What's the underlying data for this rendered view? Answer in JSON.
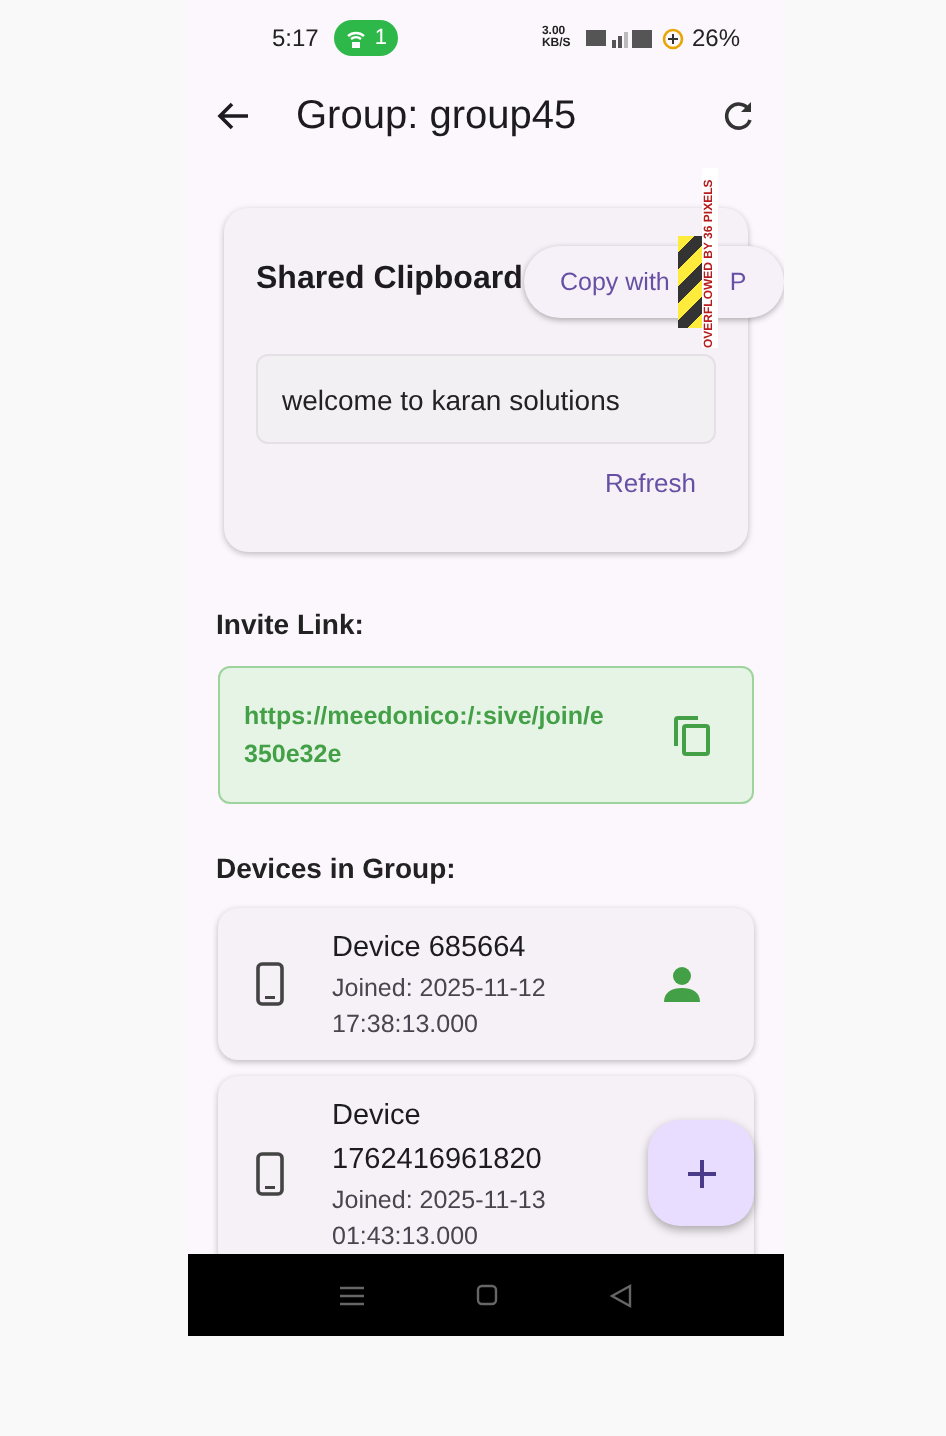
{
  "status_bar": {
    "time": "5:17",
    "hotspot_count": "1",
    "speed": "3.00 KB/S",
    "battery": "26%"
  },
  "app_bar": {
    "title": "Group: group45"
  },
  "clipboard": {
    "title": "Shared Clipboard",
    "copy_button_start": "Copy with",
    "copy_button_end": "P",
    "overflow_warning": "OVERFLOWED BY 36 PIXELS",
    "text": "welcome to karan solutions",
    "refresh": "Refresh"
  },
  "invite": {
    "heading": "Invite Link:",
    "link": "https://meedonico:/:sive/join/e350e32e"
  },
  "devices_heading": "Devices in Group:",
  "devices": [
    {
      "name": "Device 685664",
      "joined": "Joined: 2025-11-12 17:38:13.000",
      "current": true
    },
    {
      "name": "Device 1762416961820",
      "joined": "Joined: 2025-11-13 01:43:13.000"
    }
  ]
}
